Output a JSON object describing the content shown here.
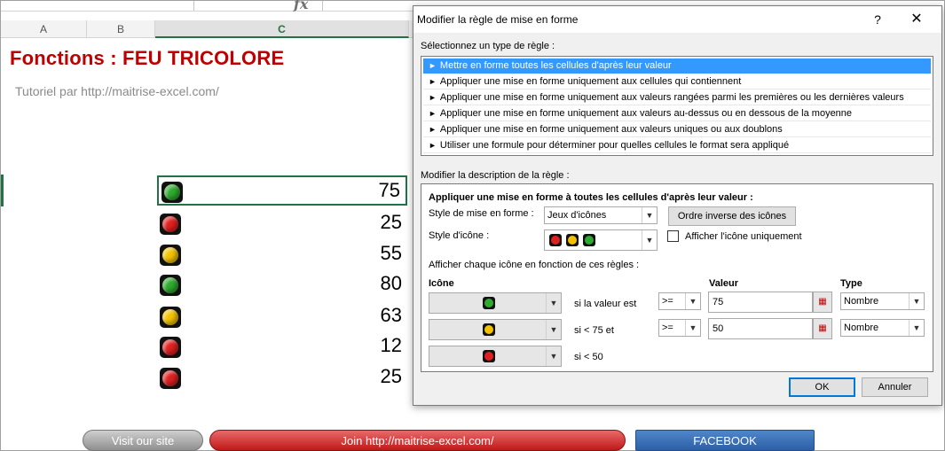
{
  "spreadsheet": {
    "formula_bar": {
      "fx_symbol": "fx"
    },
    "columns": [
      "A",
      "B",
      "C"
    ],
    "selected_column": "C",
    "title": "Fonctions : FEU TRICOLORE",
    "subtitle": "Tutoriel par http://maitrise-excel.com/",
    "rows": [
      {
        "value": "75",
        "light": "green",
        "color": "#2eaa2e"
      },
      {
        "value": "25",
        "light": "red",
        "color": "#e02020"
      },
      {
        "value": "55",
        "light": "yellow",
        "color": "#f2c200"
      },
      {
        "value": "80",
        "light": "green",
        "color": "#2eaa2e"
      },
      {
        "value": "63",
        "light": "yellow",
        "color": "#f2c200"
      },
      {
        "value": "12",
        "light": "red",
        "color": "#e02020"
      },
      {
        "value": "25",
        "light": "red",
        "color": "#e02020"
      }
    ],
    "bottom_buttons": {
      "visit": "Visit our site",
      "join": "Join http://maitrise-excel.com/",
      "facebook": "FACEBOOK"
    }
  },
  "dialog": {
    "title": "Modifier la règle de mise en forme",
    "help": "?",
    "close": "✕",
    "select_type_label": "Sélectionnez un type de règle :",
    "rule_types": [
      "Mettre en forme toutes les cellules d'après leur valeur",
      "Appliquer une mise en forme uniquement aux cellules qui contiennent",
      "Appliquer une mise en forme uniquement aux valeurs rangées parmi les premières ou les dernières valeurs",
      "Appliquer une mise en forme uniquement aux valeurs au-dessus ou en dessous de la moyenne",
      "Appliquer une mise en forme uniquement aux valeurs uniques ou aux doublons",
      "Utiliser une formule pour déterminer pour quelles cellules le format sera appliqué"
    ],
    "rule_type_arrow": "►",
    "edit_desc_label": "Modifier la description de la règle :",
    "desc_heading": "Appliquer une mise en forme à toutes les cellules d'après leur valeur :",
    "format_style_label": "Style de mise en forme :",
    "format_style_value": "Jeux d'icônes",
    "reverse_button": "Ordre inverse des icônes",
    "icon_style_label": "Style d'icône :",
    "icon_only_label": "Afficher l'icône uniquement",
    "rules_label": "Afficher chaque icône en fonction de ces règles :",
    "col_icon": "Icône",
    "col_value": "Valeur",
    "col_type": "Type",
    "icon_rules": [
      {
        "condition": "si la valeur est",
        "operator": ">=",
        "value": "75",
        "type": "Nombre",
        "color": "#2eaa2e"
      },
      {
        "condition": "si < 75 et",
        "operator": ">=",
        "value": "50",
        "type": "Nombre",
        "color": "#f2c200"
      },
      {
        "condition": "si < 50",
        "color": "#e02020"
      }
    ],
    "ok": "OK",
    "cancel": "Annuler"
  }
}
